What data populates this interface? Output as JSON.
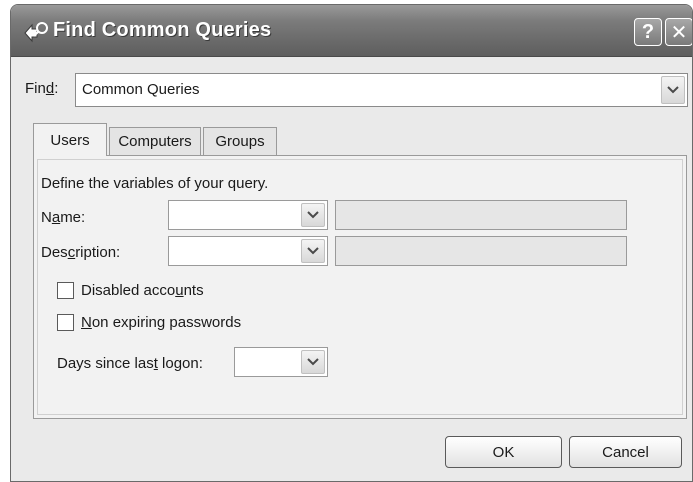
{
  "window": {
    "title": "Find Common Queries",
    "help_label": "?",
    "close_label": "✕"
  },
  "find": {
    "label_pre": "Fin",
    "label_accel": "d",
    "label_post": ":",
    "value": "Common Queries"
  },
  "tabs": [
    {
      "label": "Users",
      "active": true
    },
    {
      "label": "Computers",
      "active": false
    },
    {
      "label": "Groups",
      "active": false
    }
  ],
  "panel": {
    "intro": "Define the variables of your query.",
    "name": {
      "pre": "N",
      "accel": "a",
      "post": "me:",
      "selected": "",
      "text": ""
    },
    "description": {
      "pre": "Des",
      "accel": "c",
      "post": "ription:",
      "selected": "",
      "text": ""
    },
    "disabled_accounts": {
      "pre": "Disabled acco",
      "accel": "u",
      "post": "nts",
      "checked": false
    },
    "non_expiring": {
      "pre": "",
      "accel": "N",
      "post": "on expiring passwords",
      "checked": false
    },
    "days_since": {
      "pre": "Days since las",
      "accel": "t",
      "post": " logon:",
      "selected": ""
    }
  },
  "buttons": {
    "ok": "OK",
    "cancel": "Cancel"
  },
  "colors": {
    "titlebar": "#6e6e6e",
    "dialog_bg": "#eaeaea",
    "panel_bg": "#f2f2f2"
  }
}
